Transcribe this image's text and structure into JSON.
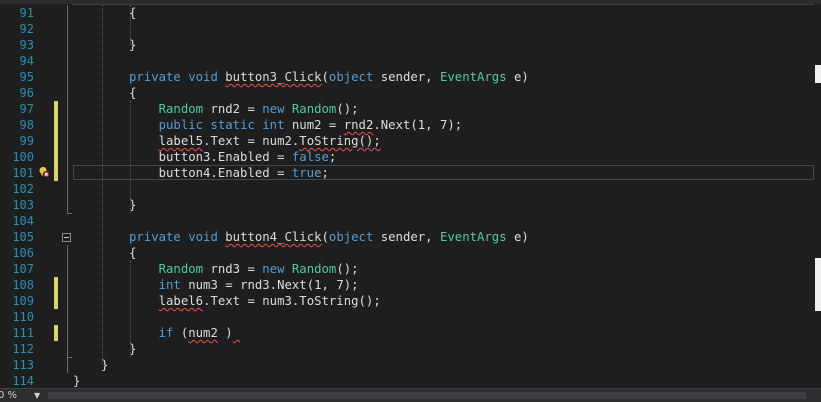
{
  "editor": {
    "lines": [
      {
        "n": "91",
        "tokens": [
          {
            "t": "{",
            "c": "id"
          }
        ]
      },
      {
        "n": "92",
        "tokens": []
      },
      {
        "n": "93",
        "tokens": [
          {
            "t": "}",
            "c": "id"
          }
        ]
      },
      {
        "n": "94",
        "tokens": []
      },
      {
        "n": "95",
        "tokens": [
          {
            "t": "private",
            "c": "kw"
          },
          {
            "t": " ",
            "c": "id"
          },
          {
            "t": "void",
            "c": "kw"
          },
          {
            "t": " ",
            "c": "id"
          },
          {
            "t": "button3_Click",
            "c": "id squig"
          },
          {
            "t": "(",
            "c": "id"
          },
          {
            "t": "object",
            "c": "kw"
          },
          {
            "t": " sender, ",
            "c": "id"
          },
          {
            "t": "EventArgs",
            "c": "ty"
          },
          {
            "t": " e)",
            "c": "id"
          }
        ]
      },
      {
        "n": "96",
        "tokens": [
          {
            "t": "{",
            "c": "id"
          }
        ]
      },
      {
        "n": "97",
        "tokens": [
          {
            "t": "    ",
            "c": "id"
          },
          {
            "t": "Random",
            "c": "ty"
          },
          {
            "t": " rnd2 = ",
            "c": "id"
          },
          {
            "t": "new",
            "c": "kw"
          },
          {
            "t": " ",
            "c": "id"
          },
          {
            "t": "Random",
            "c": "ty"
          },
          {
            "t": "();",
            "c": "id"
          }
        ]
      },
      {
        "n": "98",
        "tokens": [
          {
            "t": "    ",
            "c": "id"
          },
          {
            "t": "public",
            "c": "kw"
          },
          {
            "t": " ",
            "c": "id"
          },
          {
            "t": "static",
            "c": "kw"
          },
          {
            "t": " ",
            "c": "id"
          },
          {
            "t": "int",
            "c": "kw"
          },
          {
            "t": " num2 = ",
            "c": "id"
          },
          {
            "t": "rnd2",
            "c": "id squig"
          },
          {
            "t": ".Next(1, 7);",
            "c": "id"
          }
        ]
      },
      {
        "n": "99",
        "tokens": [
          {
            "t": "    ",
            "c": "id"
          },
          {
            "t": "label5",
            "c": "id squig"
          },
          {
            "t": ".Text = num2.",
            "c": "id"
          },
          {
            "t": "ToString();",
            "c": "id squig"
          }
        ]
      },
      {
        "n": "100",
        "tokens": [
          {
            "t": "    button3.Enabled = ",
            "c": "id"
          },
          {
            "t": "false",
            "c": "kw"
          },
          {
            "t": ";",
            "c": "id"
          }
        ]
      },
      {
        "n": "101",
        "tokens": [
          {
            "t": "    button4.Enabled = ",
            "c": "id"
          },
          {
            "t": "true",
            "c": "kw"
          },
          {
            "t": ";",
            "c": "id"
          }
        ]
      },
      {
        "n": "102",
        "tokens": []
      },
      {
        "n": "103",
        "tokens": [
          {
            "t": "}",
            "c": "id"
          }
        ]
      },
      {
        "n": "104",
        "tokens": []
      },
      {
        "n": "105",
        "tokens": [
          {
            "t": "private",
            "c": "kw"
          },
          {
            "t": " ",
            "c": "id"
          },
          {
            "t": "void",
            "c": "kw"
          },
          {
            "t": " ",
            "c": "id"
          },
          {
            "t": "button4_Click",
            "c": "id squig"
          },
          {
            "t": "(",
            "c": "id"
          },
          {
            "t": "object",
            "c": "kw"
          },
          {
            "t": " sender, ",
            "c": "id"
          },
          {
            "t": "EventArgs",
            "c": "ty"
          },
          {
            "t": " e)",
            "c": "id"
          }
        ]
      },
      {
        "n": "106",
        "tokens": [
          {
            "t": "{",
            "c": "id"
          }
        ]
      },
      {
        "n": "107",
        "tokens": [
          {
            "t": "    ",
            "c": "id"
          },
          {
            "t": "Random",
            "c": "ty"
          },
          {
            "t": " rnd3 = ",
            "c": "id"
          },
          {
            "t": "new",
            "c": "kw"
          },
          {
            "t": " ",
            "c": "id"
          },
          {
            "t": "Random",
            "c": "ty"
          },
          {
            "t": "();",
            "c": "id"
          }
        ]
      },
      {
        "n": "108",
        "tokens": [
          {
            "t": "    ",
            "c": "id"
          },
          {
            "t": "int",
            "c": "kw"
          },
          {
            "t": " num3 = rnd3.Next(1, 7);",
            "c": "id"
          }
        ]
      },
      {
        "n": "109",
        "tokens": [
          {
            "t": "    ",
            "c": "id"
          },
          {
            "t": "label6",
            "c": "id squig"
          },
          {
            "t": ".Text = num3.ToString();",
            "c": "id"
          }
        ]
      },
      {
        "n": "110",
        "tokens": []
      },
      {
        "n": "111",
        "tokens": [
          {
            "t": "    ",
            "c": "id"
          },
          {
            "t": "if",
            "c": "kw"
          },
          {
            "t": " (",
            "c": "id"
          },
          {
            "t": "num2",
            "c": "id squig"
          },
          {
            "t": " )",
            "c": "id"
          },
          {
            "t": " ",
            "c": "id squig"
          }
        ]
      },
      {
        "n": "112",
        "tokens": [
          {
            "t": "}",
            "c": "id"
          }
        ]
      },
      {
        "n": "113",
        "tokens": [
          {
            "t": "}",
            "c": "id"
          }
        ]
      },
      {
        "n": "114",
        "tokens": [
          {
            "t": "}",
            "c": "id squig"
          }
        ]
      }
    ]
  },
  "status": {
    "zoom": "0 %",
    "zoom_arrow": "▼"
  },
  "colors": {
    "keyword": "#569cd6",
    "type": "#4ec9b0",
    "text": "#dcdcdc",
    "line_number": "#2b91af",
    "change_marker": "#d7d76c",
    "error_squiggle": "#f14c4c"
  },
  "icons": {
    "breakpoint": "lightbulb-error-icon",
    "fold": "collapse-icon"
  }
}
